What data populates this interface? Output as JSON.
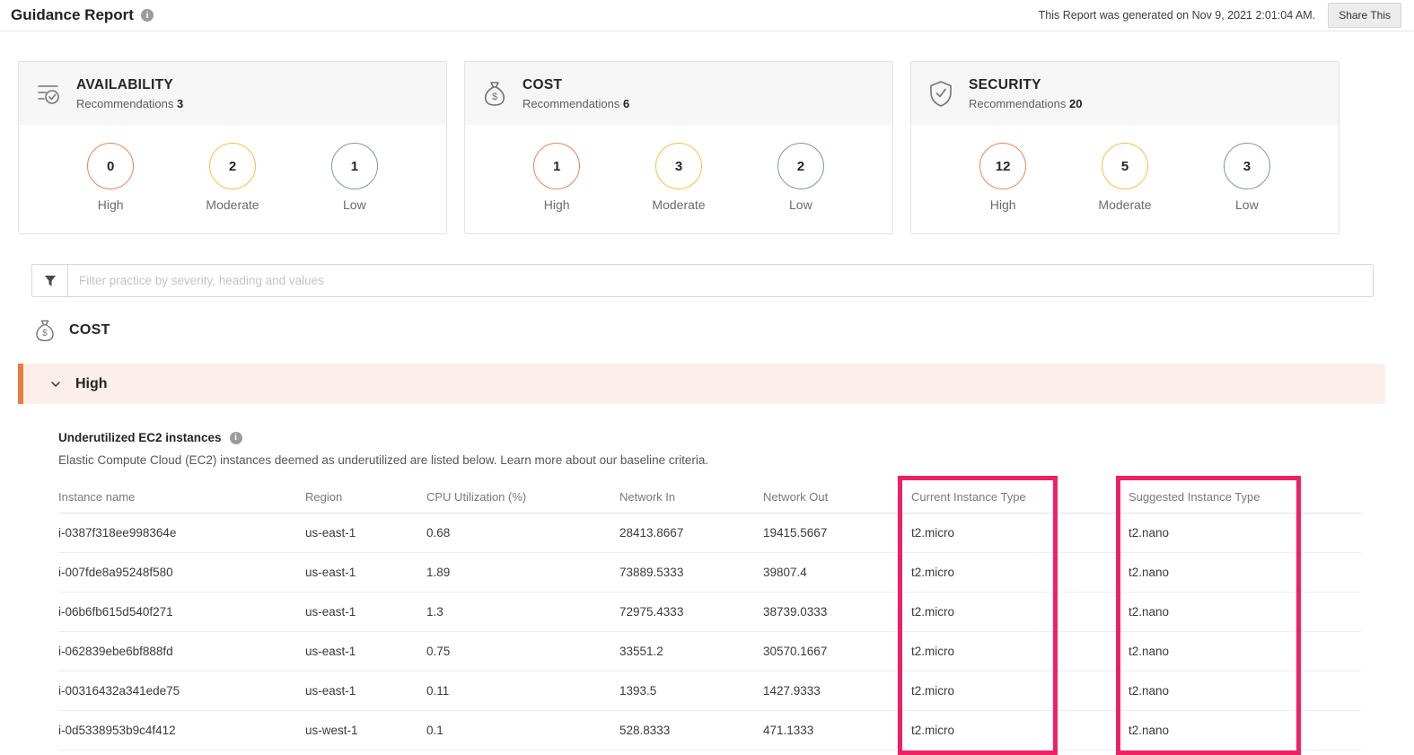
{
  "header": {
    "title": "Guidance Report",
    "generated_text": "This Report was generated on Nov 9, 2021 2:01:04 AM.",
    "share_button_label": "Share This"
  },
  "cards": [
    {
      "title": "AVAILABILITY",
      "icon": "availability-checklist-icon",
      "recommendations_label": "Recommendations",
      "count": "3",
      "severities": [
        {
          "label": "High",
          "value": "0"
        },
        {
          "label": "Moderate",
          "value": "2"
        },
        {
          "label": "Low",
          "value": "1"
        }
      ]
    },
    {
      "title": "COST",
      "icon": "money-bag-icon",
      "recommendations_label": "Recommendations",
      "count": "6",
      "severities": [
        {
          "label": "High",
          "value": "1"
        },
        {
          "label": "Moderate",
          "value": "3"
        },
        {
          "label": "Low",
          "value": "2"
        }
      ]
    },
    {
      "title": "SECURITY",
      "icon": "shield-check-icon",
      "recommendations_label": "Recommendations",
      "count": "20",
      "severities": [
        {
          "label": "High",
          "value": "12"
        },
        {
          "label": "Moderate",
          "value": "5"
        },
        {
          "label": "Low",
          "value": "3"
        }
      ]
    }
  ],
  "filter": {
    "placeholder": "Filter practice by severity, heading and values"
  },
  "cost_section": {
    "title": "COST"
  },
  "accordion": {
    "label": "High"
  },
  "practice": {
    "title": "Underutilized EC2 instances",
    "description": "Elastic Compute Cloud (EC2) instances deemed as underutilized are listed below. Learn more about our baseline criteria."
  },
  "table": {
    "columns": [
      "Instance name",
      "Region",
      "CPU Utilization (%)",
      "Network In",
      "Network Out",
      "Current Instance Type",
      "Suggested Instance Type"
    ],
    "rows": [
      [
        "i-0387f318ee998364e",
        "us-east-1",
        "0.68",
        "28413.8667",
        "19415.5667",
        "t2.micro",
        "t2.nano"
      ],
      [
        "i-007fde8a95248f580",
        "us-east-1",
        "1.89",
        "73889.5333",
        "39807.4",
        "t2.micro",
        "t2.nano"
      ],
      [
        "i-06b6fb615d540f271",
        "us-east-1",
        "1.3",
        "72975.4333",
        "38739.0333",
        "t2.micro",
        "t2.nano"
      ],
      [
        "i-062839ebe6bf888fd",
        "us-east-1",
        "0.75",
        "33551.2",
        "30570.1667",
        "t2.micro",
        "t2.nano"
      ],
      [
        "i-00316432a341ede75",
        "us-east-1",
        "0.11",
        "1393.5",
        "1427.9333",
        "t2.micro",
        "t2.nano"
      ],
      [
        "i-0d5338953b9c4f412",
        "us-west-1",
        "0.1",
        "528.8333",
        "471.1333",
        "t2.micro",
        "t2.nano"
      ]
    ]
  },
  "colors": {
    "severity_high": "#e8865c",
    "severity_moderate": "#f0c24b",
    "severity_low": "#7d97a9",
    "accordion_accent": "#e87d40",
    "accordion_background": "#fcefea",
    "column_highlight": "#ef2164"
  }
}
